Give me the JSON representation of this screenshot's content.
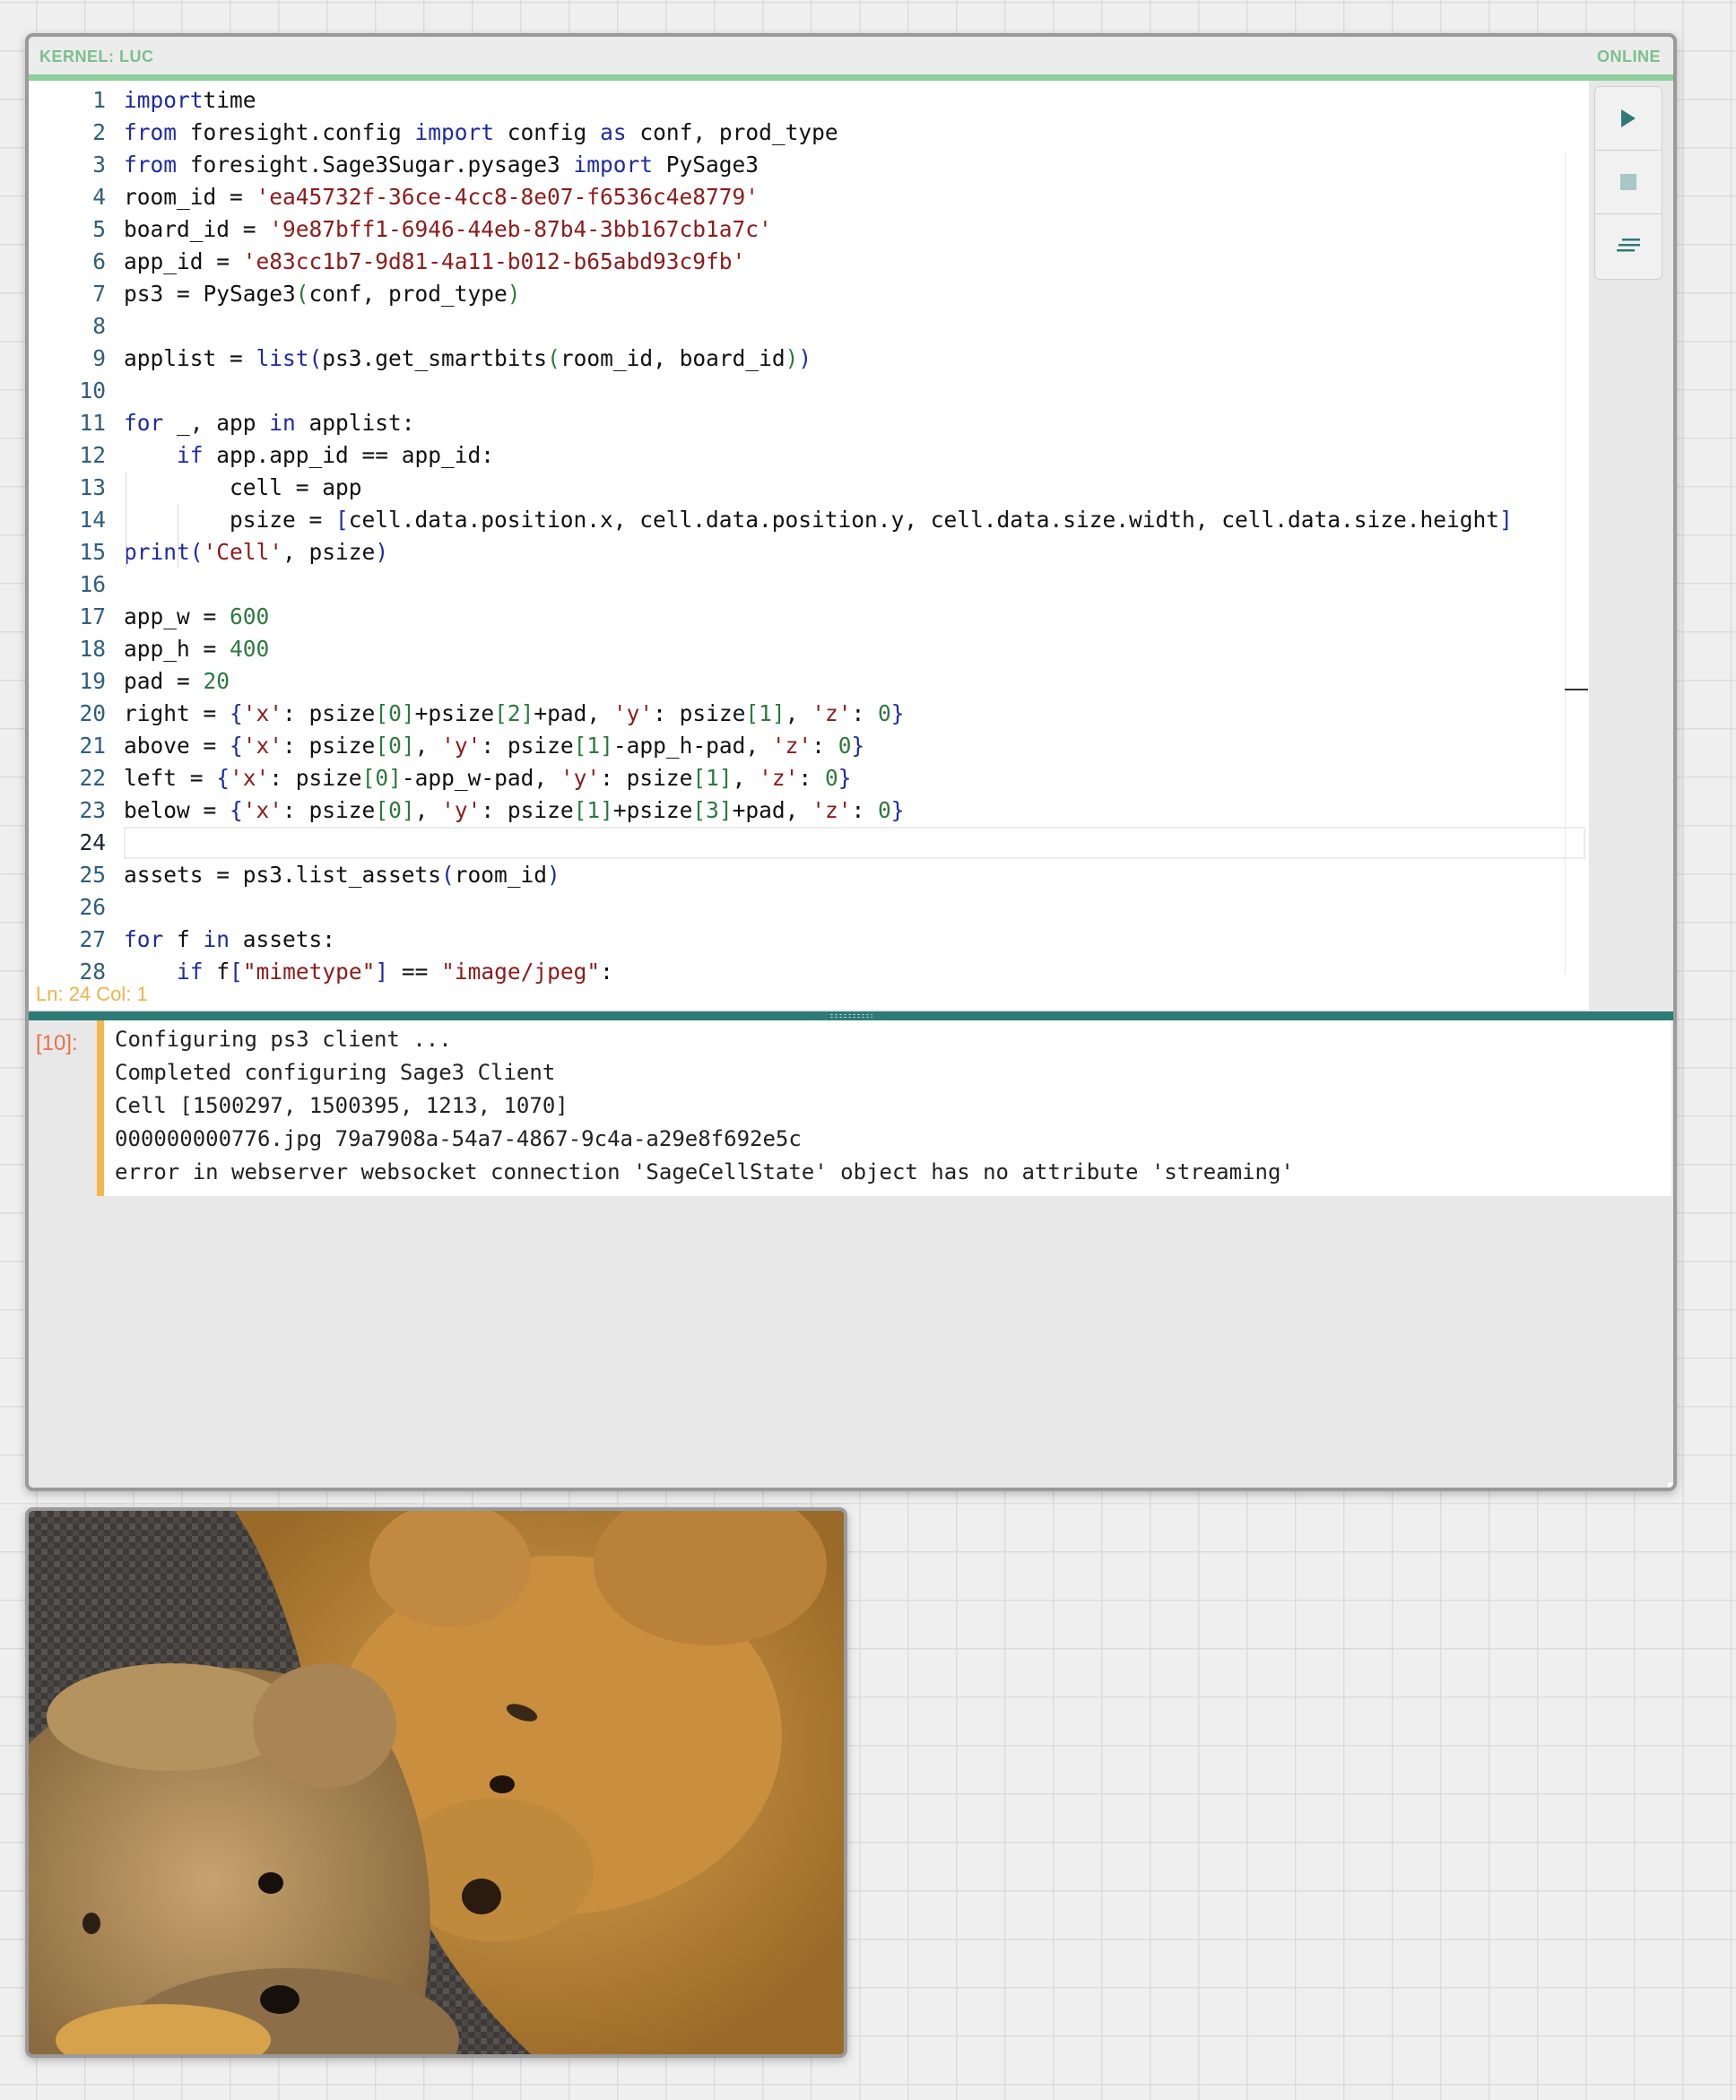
{
  "kernel": {
    "label": "KERNEL: LUC",
    "status": "ONLINE",
    "accent_color": "#8fcf9a"
  },
  "editor": {
    "current_line": 24,
    "lines": [
      {
        "n": "1",
        "t": [
          [
            "kw",
            "import"
          ],
          [
            "",
            "time"
          ]
        ]
      },
      {
        "n": "2",
        "t": [
          [
            "kw",
            "from"
          ],
          [
            "",
            " foresight.config "
          ],
          [
            "kw",
            "import"
          ],
          [
            "",
            " config "
          ],
          [
            "kw",
            "as"
          ],
          [
            "",
            " conf, prod_type"
          ]
        ]
      },
      {
        "n": "3",
        "t": [
          [
            "kw",
            "from"
          ],
          [
            "",
            " foresight.Sage3Sugar.pysage3 "
          ],
          [
            "kw",
            "import"
          ],
          [
            "",
            " PySage3"
          ]
        ]
      },
      {
        "n": "4",
        "t": [
          [
            "",
            "room_id = "
          ],
          [
            "str",
            "'ea45732f-36ce-4cc8-8e07-f6536c4e8779'"
          ]
        ]
      },
      {
        "n": "5",
        "t": [
          [
            "",
            "board_id = "
          ],
          [
            "str",
            "'9e87bff1-6946-44eb-87b4-3bb167cb1a7c'"
          ]
        ]
      },
      {
        "n": "6",
        "t": [
          [
            "",
            "app_id = "
          ],
          [
            "str",
            "'e83cc1b7-9d81-4a11-b012-b65abd93c9fb'"
          ]
        ]
      },
      {
        "n": "7",
        "t": [
          [
            "",
            "ps3 = PySage3"
          ],
          [
            "num",
            "("
          ],
          [
            "",
            "conf, prod_type"
          ],
          [
            "num",
            ")"
          ]
        ]
      },
      {
        "n": "8",
        "t": []
      },
      {
        "n": "9",
        "t": [
          [
            "",
            "applist = "
          ],
          [
            "kw",
            "list"
          ],
          [
            "br",
            "("
          ],
          [
            "",
            "ps3.get_smartbits"
          ],
          [
            "num",
            "("
          ],
          [
            "",
            "room_id, board_id"
          ],
          [
            "num",
            ")"
          ],
          [
            "br",
            ")"
          ]
        ]
      },
      {
        "n": "10",
        "t": []
      },
      {
        "n": "11",
        "t": [
          [
            "kw",
            "for"
          ],
          [
            "",
            " _, app "
          ],
          [
            "kw",
            "in"
          ],
          [
            "",
            " applist:"
          ]
        ]
      },
      {
        "n": "12",
        "t": [
          [
            "",
            "    "
          ],
          [
            "kw",
            "if"
          ],
          [
            "",
            " app.app_id == app_id:"
          ]
        ]
      },
      {
        "n": "13",
        "t": [
          [
            "",
            "        cell = app"
          ]
        ]
      },
      {
        "n": "14",
        "t": [
          [
            "",
            "        psize = "
          ],
          [
            "br",
            "["
          ],
          [
            "",
            "cell.data.position.x, cell.data.position.y, cell.data.size.width, cell.data.size.height"
          ],
          [
            "br",
            "]"
          ]
        ]
      },
      {
        "n": "15",
        "t": [
          [
            "kw",
            "print"
          ],
          [
            "br",
            "("
          ],
          [
            "str",
            "'Cell'"
          ],
          [
            "",
            ", psize"
          ],
          [
            "br",
            ")"
          ]
        ]
      },
      {
        "n": "16",
        "t": []
      },
      {
        "n": "17",
        "t": [
          [
            "",
            "app_w = "
          ],
          [
            "num",
            "600"
          ]
        ]
      },
      {
        "n": "18",
        "t": [
          [
            "",
            "app_h = "
          ],
          [
            "num",
            "400"
          ]
        ]
      },
      {
        "n": "19",
        "t": [
          [
            "",
            "pad = "
          ],
          [
            "num",
            "20"
          ]
        ]
      },
      {
        "n": "20",
        "t": [
          [
            "",
            "right = "
          ],
          [
            "br",
            "{"
          ],
          [
            "str",
            "'x'"
          ],
          [
            "",
            ": psize"
          ],
          [
            "num",
            "[0]"
          ],
          [
            "",
            "+psize"
          ],
          [
            "num",
            "[2]"
          ],
          [
            "",
            "+pad, "
          ],
          [
            "str",
            "'y'"
          ],
          [
            "",
            ": psize"
          ],
          [
            "num",
            "[1]"
          ],
          [
            "",
            ", "
          ],
          [
            "str",
            "'z'"
          ],
          [
            "",
            ": "
          ],
          [
            "num",
            "0"
          ],
          [
            "br",
            "}"
          ]
        ]
      },
      {
        "n": "21",
        "t": [
          [
            "",
            "above = "
          ],
          [
            "br",
            "{"
          ],
          [
            "str",
            "'x'"
          ],
          [
            "",
            ": psize"
          ],
          [
            "num",
            "[0]"
          ],
          [
            "",
            ", "
          ],
          [
            "str",
            "'y'"
          ],
          [
            "",
            ": psize"
          ],
          [
            "num",
            "[1]"
          ],
          [
            "",
            "-app_h-pad, "
          ],
          [
            "str",
            "'z'"
          ],
          [
            "",
            ": "
          ],
          [
            "num",
            "0"
          ],
          [
            "br",
            "}"
          ]
        ]
      },
      {
        "n": "22",
        "t": [
          [
            "",
            "left = "
          ],
          [
            "br",
            "{"
          ],
          [
            "str",
            "'x'"
          ],
          [
            "",
            ": psize"
          ],
          [
            "num",
            "[0]"
          ],
          [
            "",
            "-app_w-pad, "
          ],
          [
            "str",
            "'y'"
          ],
          [
            "",
            ": psize"
          ],
          [
            "num",
            "[1]"
          ],
          [
            "",
            ", "
          ],
          [
            "str",
            "'z'"
          ],
          [
            "",
            ": "
          ],
          [
            "num",
            "0"
          ],
          [
            "br",
            "}"
          ]
        ]
      },
      {
        "n": "23",
        "t": [
          [
            "",
            "below = "
          ],
          [
            "br",
            "{"
          ],
          [
            "str",
            "'x'"
          ],
          [
            "",
            ": psize"
          ],
          [
            "num",
            "[0]"
          ],
          [
            "",
            ", "
          ],
          [
            "str",
            "'y'"
          ],
          [
            "",
            ": psize"
          ],
          [
            "num",
            "[1]"
          ],
          [
            "",
            "+psize"
          ],
          [
            "num",
            "[3]"
          ],
          [
            "",
            "+pad, "
          ],
          [
            "str",
            "'z'"
          ],
          [
            "",
            ": "
          ],
          [
            "num",
            "0"
          ],
          [
            "br",
            "}"
          ]
        ]
      },
      {
        "n": "24",
        "t": []
      },
      {
        "n": "25",
        "t": [
          [
            "",
            "assets = ps3.list_assets"
          ],
          [
            "br",
            "("
          ],
          [
            "",
            "room_id"
          ],
          [
            "br",
            ")"
          ]
        ]
      },
      {
        "n": "26",
        "t": []
      },
      {
        "n": "27",
        "t": [
          [
            "kw",
            "for"
          ],
          [
            "",
            " f "
          ],
          [
            "kw",
            "in"
          ],
          [
            "",
            " assets:"
          ]
        ]
      },
      {
        "n": "28",
        "t": [
          [
            "",
            "    "
          ],
          [
            "kw",
            "if"
          ],
          [
            "",
            " f"
          ],
          [
            "br",
            "["
          ],
          [
            "str",
            "\"mimetype\""
          ],
          [
            "br",
            "]"
          ],
          [
            "",
            " == "
          ],
          [
            "str",
            "\"image/jpeg\""
          ],
          [
            "",
            ":"
          ]
        ]
      }
    ]
  },
  "toolbar": {
    "run": "play-icon",
    "stop": "stop-icon",
    "clear": "clear-output-icon"
  },
  "status_bar": {
    "position": "Ln: 24 Col: 1"
  },
  "output": {
    "exec_count": "[10]:",
    "lines": [
      "Configuring ps3 client ...",
      "Completed configuring Sage3 Client",
      "Cell [1500297, 1500395, 1213, 1070]",
      "000000000776.jpg 79a7908a-54a7-4867-9c4a-a29e8f692e5c",
      "error in webserver websocket connection 'SageCellState' object has no attribute 'streaming'"
    ]
  },
  "image_app": {
    "subject": "teddy-bears-photo"
  }
}
